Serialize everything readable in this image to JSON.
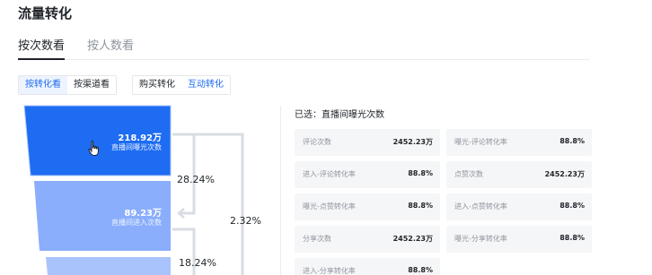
{
  "page": {
    "title": "流量转化"
  },
  "tabs": [
    {
      "label": "按次数看",
      "active": true
    },
    {
      "label": "按人数看",
      "active": false
    }
  ],
  "segments_a": [
    {
      "label": "按转化看",
      "selected": true
    },
    {
      "label": "按渠道看",
      "selected": false
    }
  ],
  "segments_b": [
    {
      "label": "购买转化",
      "selected": false
    },
    {
      "label": "互动转化",
      "selected": true
    }
  ],
  "funnel": {
    "stages": [
      {
        "value": "218.92万",
        "label": "直播间曝光次数",
        "color": "#1e6cf2"
      },
      {
        "value": "89.23万",
        "label": "直播间进入次数",
        "color": "#8aaefc"
      },
      {
        "value": "",
        "label": "",
        "color": "#a9c3fd"
      }
    ],
    "step_rates": [
      "28.24%",
      "18.24%"
    ],
    "overall_rate": "2.32%"
  },
  "selected_panel": {
    "text": "已选：直播间曝光次数"
  },
  "metrics": [
    {
      "name": "评论次数",
      "value": "2452.23万"
    },
    {
      "name": "曝光-评论转化率",
      "value": "88.8%"
    },
    {
      "name": "进入-评论转化率",
      "value": "88.8%"
    },
    {
      "name": "点赞次数",
      "value": "2452.23万"
    },
    {
      "name": "曝光-点赞转化率",
      "value": "88.8%"
    },
    {
      "name": "进入-点赞转化率",
      "value": "88.8%"
    },
    {
      "name": "分享次数",
      "value": "2452.23万"
    },
    {
      "name": "曝光-分享转化率",
      "value": "88.8%"
    },
    {
      "name": "进入-分享转化率",
      "value": "88.8%"
    }
  ],
  "colors": {
    "accent": "#1e6cf2",
    "connector": "#d8dce3"
  }
}
